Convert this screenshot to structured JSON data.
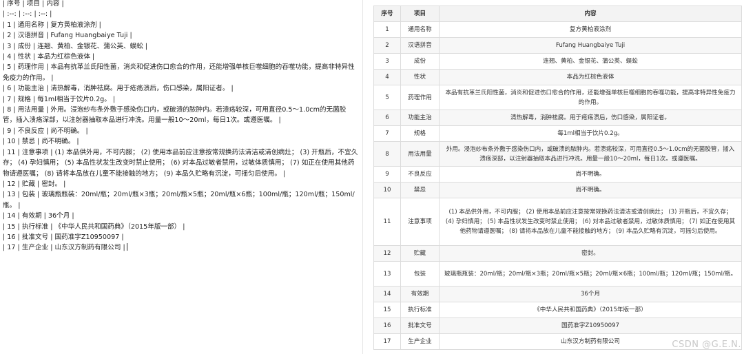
{
  "editor": {
    "lines": [
      "| 序号 | 项目 | 内容 |",
      "| :--: | :--: | :--: |",
      "| 1 | 通用名称 | 复方黄柏液涂剂 |",
      "| 2 | 汉语拼音 | Fufang Huangbaiye Tuji |",
      "| 3 | 成份 | 连翘、黄柏、金银花、蒲公英、蜈蚣 |",
      "| 4 | 性状 | 本品为红棕色液体 |",
      "| 5 | 药理作用 | 本品有抗革兰氏阳性菌，消炎和促进伤口愈合的作用，还能增强单核巨噬细胞的吞噬功能，提高非特异性免疫力的作用。 |",
      "| 6 | 功能主治 | 清热解毒，消肿祛腐。用于疮疡溃后，伤口感染，属阳证者。 |",
      "| 7 | 规格 | 每1ml相当于饮片0.2g。 |",
      "| 8 | 用法用量 | 外用。浸泡纱布条外敷于感染伤口内，或破溃的脓肿内。若溃疡较深，可用直径0.5～1.0cm的无菌胶管，插入溃疡深部，以注射器抽取本品进行冲洗。用量一般10～20ml，每日1次。或遵医嘱。 |",
      "| 9 | 不良反应 | 尚不明确。 |",
      "| 10 | 禁忌 | 尚不明确。 |",
      "| 11 | 注意事项 | (1) 本品供外用，不可内服； (2) 使用本品前应注意按常规换药法清洁或清创病灶； (3) 开瓶后，不宜久存； (4) 孕妇慎用； (5) 本品性状发生改变时禁止使用； (6) 对本品过敏者禁用，过敏体质慎用； (7) 如正在使用其他药物请遵医嘱； (8) 请将本品放在儿童不能接触的地方； (9) 本品久贮略有沉淀，可摇匀后使用。 |",
      "| 12 | 贮藏 | 密封。 |",
      "| 13 | 包装 | 玻璃瓶瓶装：20ml/瓶；20ml/瓶×3瓶；20ml/瓶×5瓶；20ml/瓶×6瓶；100ml/瓶；120ml/瓶；150ml/瓶。 |",
      "| 14 | 有效期 | 36个月 |",
      "| 15 | 执行标准 | 《中华人民共和国药典》（2015年版一部） |",
      "| 16 | 批准文号 | 国药准字Z10950097 |",
      "| 17 | 生产企业 | 山东汉方制药有限公司 |"
    ]
  },
  "preview": {
    "headers": [
      "序号",
      "项目",
      "内容"
    ],
    "rows": [
      [
        "1",
        "通用名称",
        "复方黄柏液涂剂"
      ],
      [
        "2",
        "汉语拼音",
        "Fufang Huangbaiye Tuji"
      ],
      [
        "3",
        "成份",
        "连翘、黄柏、金银花、蒲公英、蜈蚣"
      ],
      [
        "4",
        "性状",
        "本品为红棕色液体"
      ],
      [
        "5",
        "药理作用",
        "本品有抗革兰氏阳性菌，消炎和促进伤口愈合的作用，还能增强单核巨噬细胞的吞噬功能，提高非特异性免疫力的作用。"
      ],
      [
        "6",
        "功能主治",
        "清热解毒，消肿祛腐。用于疮疡溃后，伤口感染，属阳证者。"
      ],
      [
        "7",
        "规格",
        "每1ml相当于饮片0.2g。"
      ],
      [
        "8",
        "用法用量",
        "外用。浸泡纱布条外敷于感染伤口内，或破溃的脓肿内。若溃疡较深，可用直径0.5～1.0cm的无菌胶管，插入溃疡深部，以注射器抽取本品进行冲洗。用量一般10～20ml，每日1次。或遵医嘱。"
      ],
      [
        "9",
        "不良反应",
        "尚不明确。"
      ],
      [
        "10",
        "禁忌",
        "尚不明确。"
      ],
      [
        "11",
        "注意事项",
        "(1) 本品供外用，不可内服； (2) 使用本品前应注意按常规换药法清洁或清创病灶； (3) 开瓶后，不宜久存； (4) 孕妇慎用； (5) 本品性状发生改变时禁止使用； (6) 对本品过敏者禁用，过敏体质慎用； (7) 如正在使用其他药物请遵医嘱； (8) 请将本品放在儿童不能接触的地方； (9) 本品久贮略有沉淀，可摇匀后使用。"
      ],
      [
        "12",
        "贮藏",
        "密封。"
      ],
      [
        "13",
        "包装",
        "玻璃瓶瓶装：20ml/瓶；20ml/瓶×3瓶；20ml/瓶×5瓶；20ml/瓶×6瓶；100ml/瓶；120ml/瓶；150ml/瓶。"
      ],
      [
        "14",
        "有效期",
        "36个月"
      ],
      [
        "15",
        "执行标准",
        "《中华人民共和国药典》（2015年版一部）"
      ],
      [
        "16",
        "批准文号",
        "国药准字Z10950097"
      ],
      [
        "17",
        "生产企业",
        "山东汉方制药有限公司"
      ]
    ]
  },
  "watermark": "CSDN @G.E.N."
}
